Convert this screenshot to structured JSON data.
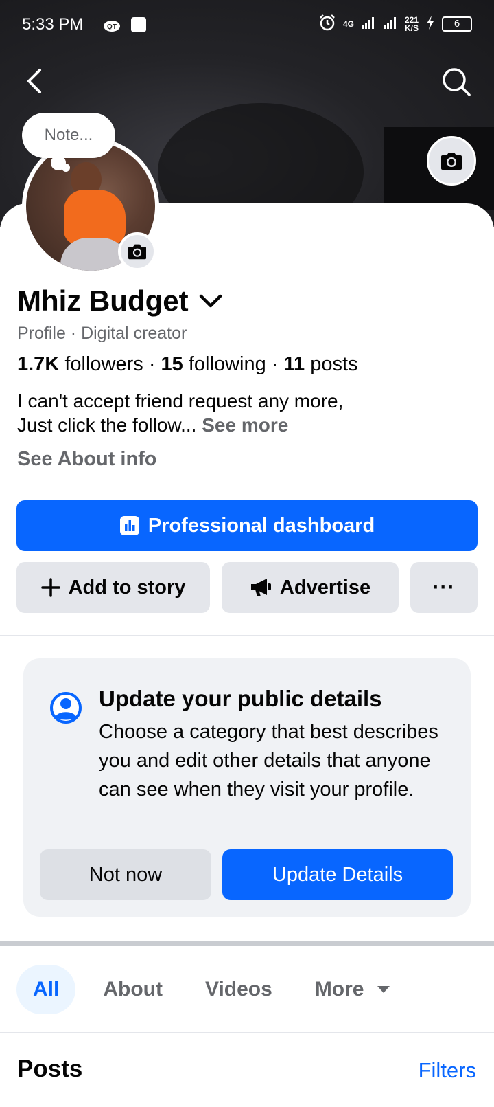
{
  "status_bar": {
    "time": "5:33 PM",
    "network_label": "4G",
    "speed_value": "221",
    "speed_unit": "K/S",
    "battery": "6"
  },
  "profile": {
    "note_placeholder": "Note...",
    "name": "Mhiz Budget",
    "subtitle": "Profile · Digital creator",
    "followers_count": "1.7K",
    "followers_label": "followers",
    "following_count": "15",
    "following_label": "following",
    "posts_count": "11",
    "posts_label": "posts",
    "bio_line1": "I can't accept friend request any more,",
    "bio_line2": "Just click the follow...",
    "see_more": "See more",
    "see_about": "See About info"
  },
  "actions": {
    "professional_dashboard": "Professional dashboard",
    "add_to_story": "Add to story",
    "advertise": "Advertise",
    "more": "···"
  },
  "update_card": {
    "title": "Update your public details",
    "body": "Choose a category that best describes you and edit other details that anyone can see when they visit your profile.",
    "not_now": "Not now",
    "update_details": "Update Details"
  },
  "tabs": [
    {
      "label": "All"
    },
    {
      "label": "About"
    },
    {
      "label": "Videos"
    },
    {
      "label": "More"
    }
  ],
  "posts_section": {
    "title": "Posts",
    "filters": "Filters"
  },
  "colors": {
    "accent": "#0866ff",
    "secondary_text": "#65676b",
    "gray_button": "#e4e6eb"
  }
}
